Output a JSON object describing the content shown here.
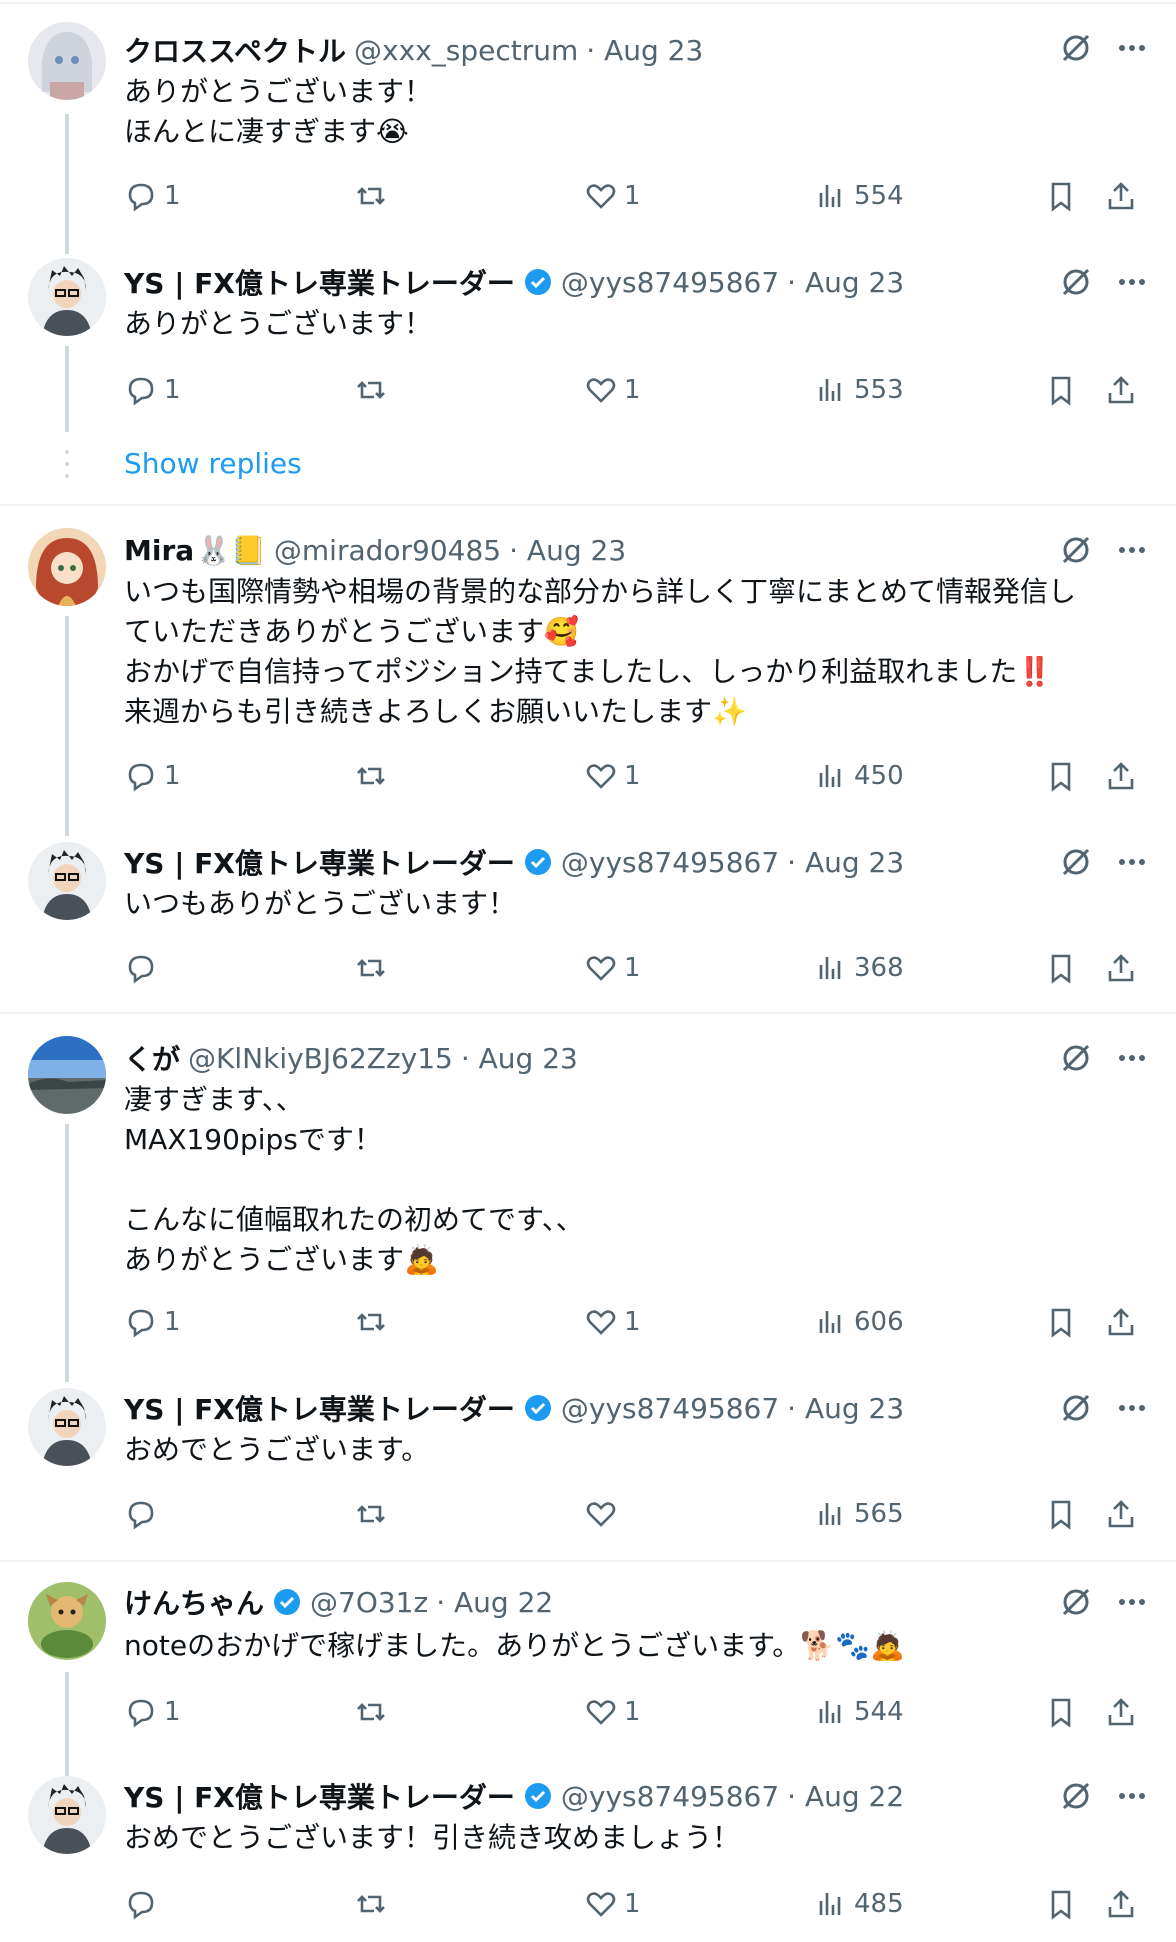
{
  "colors": {
    "accent": "#1d9bf0",
    "muted": "#536471",
    "text": "#0f1419",
    "divider": "#eff3f4",
    "verified": "#1d9bf0"
  },
  "show_replies_label": "Show replies",
  "tweets": [
    {
      "name": "クロススペクトル",
      "verified": false,
      "emoji": "",
      "handle": "@xxx_spectrum",
      "date": "· Aug 23",
      "body": "ありがとうございます！\nほんとに凄すぎます😭",
      "replies": "1",
      "retweets": "",
      "likes": "1",
      "views": "554"
    },
    {
      "name": "YS | FX億トレ専業トレーダー",
      "verified": true,
      "emoji": "",
      "handle": "@yys87495867",
      "date": "· Aug 23",
      "body": "ありがとうございます！",
      "replies": "1",
      "retweets": "",
      "likes": "1",
      "views": "553"
    },
    {
      "name": "Mira",
      "verified": false,
      "emoji": "🐰📒",
      "handle": "@mirador90485",
      "date": "· Aug 23",
      "body": "いつも国際情勢や相場の背景的な部分から詳しく丁寧にまとめて情報発信し\nていただきありがとうございます🥰\nおかげで自信持ってポジション持てましたし、しっかり利益取れました‼️\n来週からも引き続きよろしくお願いいたします✨",
      "replies": "1",
      "retweets": "",
      "likes": "1",
      "views": "450"
    },
    {
      "name": "YS | FX億トレ専業トレーダー",
      "verified": true,
      "emoji": "",
      "handle": "@yys87495867",
      "date": "· Aug 23",
      "body": "いつもありがとうございます！",
      "replies": "",
      "retweets": "",
      "likes": "1",
      "views": "368"
    },
    {
      "name": "くが",
      "verified": false,
      "emoji": "",
      "handle": "@KlNkiyBJ62Zzy15",
      "date": "· Aug 23",
      "body": "凄すぎます、、\nMAX190pipsです！\n\nこんなに値幅取れたの初めてです、、\nありがとうございます🙇",
      "replies": "1",
      "retweets": "",
      "likes": "1",
      "views": "606"
    },
    {
      "name": "YS | FX億トレ専業トレーダー",
      "verified": true,
      "emoji": "",
      "handle": "@yys87495867",
      "date": "· Aug 23",
      "body": "おめでとうございます。",
      "replies": "",
      "retweets": "",
      "likes": "",
      "views": "565"
    },
    {
      "name": "けんちゃん",
      "verified": true,
      "emoji": "",
      "handle": "@7O31z",
      "date": "· Aug 22",
      "body": "noteのおかげで稼げました。ありがとうございます。🐕🐾🙇",
      "replies": "1",
      "retweets": "",
      "likes": "1",
      "views": "544"
    },
    {
      "name": "YS | FX億トレ専業トレーダー",
      "verified": true,
      "emoji": "",
      "handle": "@yys87495867",
      "date": "· Aug 22",
      "body": "おめでとうございます！引き続き攻めましょう！",
      "replies": "",
      "retweets": "",
      "likes": "1",
      "views": "485"
    }
  ]
}
